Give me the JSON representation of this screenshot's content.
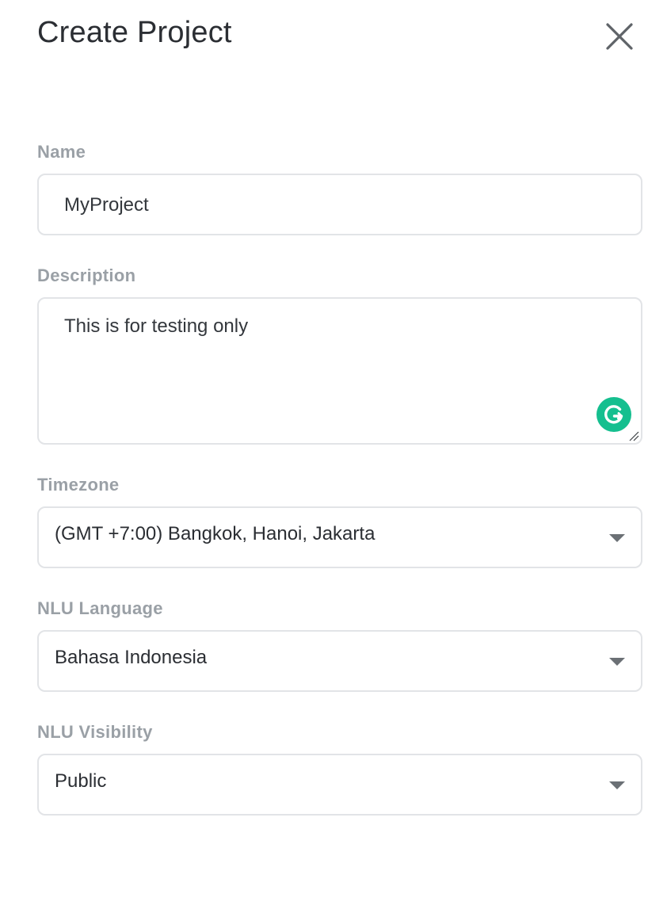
{
  "dialog": {
    "title": "Create Project",
    "close_icon": "close-icon"
  },
  "form": {
    "name": {
      "label": "Name",
      "value": "MyProject"
    },
    "description": {
      "label": "Description",
      "value": "This is for testing only",
      "grammarly_icon": "grammarly-icon"
    },
    "timezone": {
      "label": "Timezone",
      "selected": "(GMT +7:00) Bangkok, Hanoi, Jakarta",
      "icon": "chevron-down-icon"
    },
    "nlu_language": {
      "label": "NLU Language",
      "selected": "Bahasa Indonesia",
      "icon": "chevron-down-icon"
    },
    "nlu_visibility": {
      "label": "NLU Visibility",
      "selected": "Public",
      "icon": "chevron-down-icon"
    }
  },
  "colors": {
    "label": "#9aa0a6",
    "border": "#e2e4e7",
    "text": "#2b2e33",
    "grammarly": "#15bf8f"
  }
}
